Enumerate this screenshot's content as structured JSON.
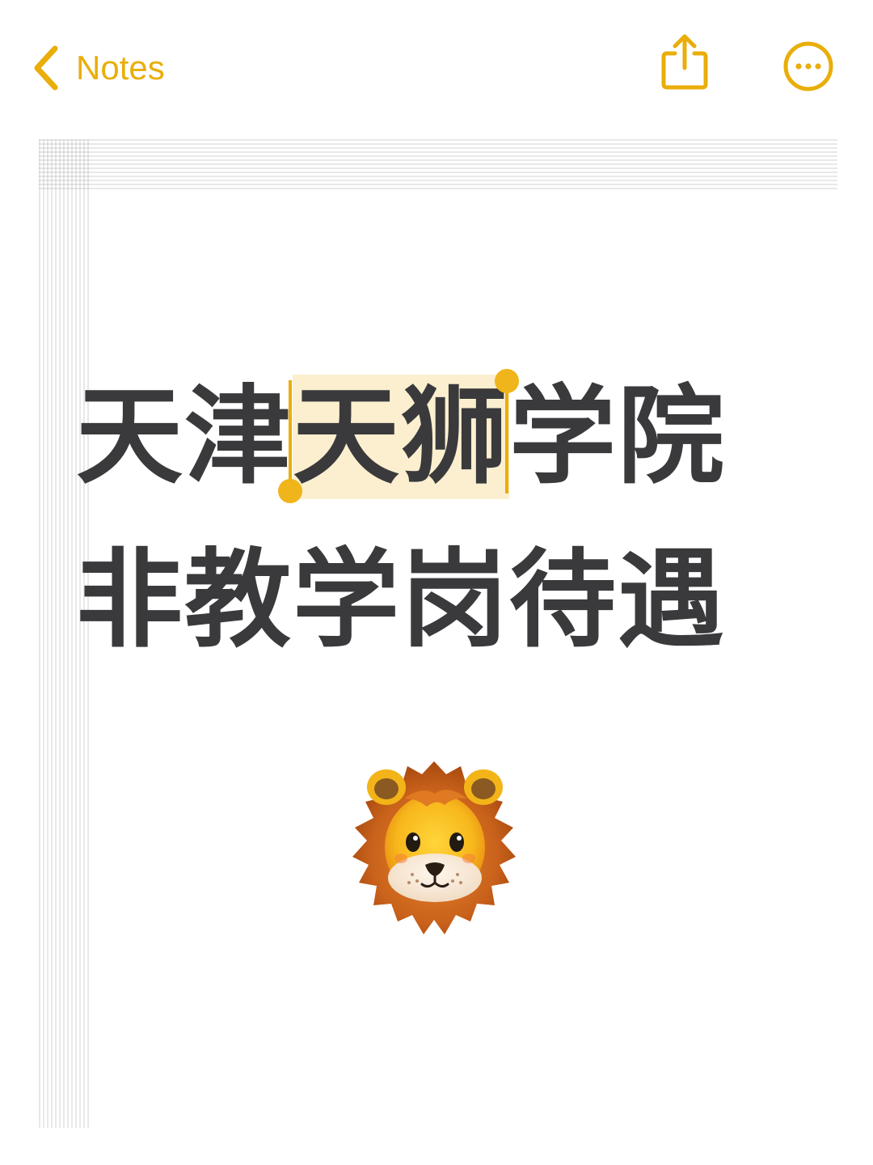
{
  "nav": {
    "back_label": "Notes",
    "accent_color": "#E9AE0A",
    "back_icon": "chevron-left-icon",
    "share_icon": "share-icon",
    "more_icon": "ellipsis-circle-icon"
  },
  "note": {
    "line1_before": "天津",
    "line1_selected": "天狮",
    "line1_after": "学院",
    "line2": "非教学岗待遇",
    "emoji": "lion-face-emoji",
    "selection_color": "#FBEFCF",
    "text_color": "#3a3a3c"
  }
}
